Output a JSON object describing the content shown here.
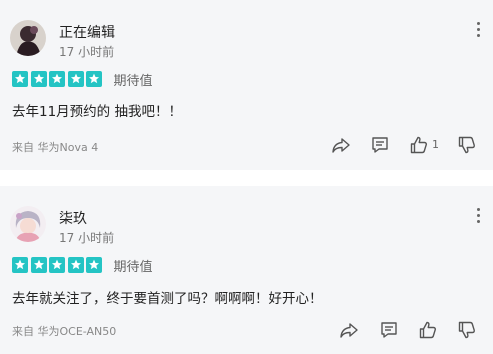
{
  "reviews": [
    {
      "username": "正在编辑",
      "time": "17 小时前",
      "rating_label": "期待值",
      "stars": 5,
      "content": "去年11月预约的 抽我吧！！",
      "device_prefix": "来自 ",
      "device": "华为Nova 4",
      "like_count": "1"
    },
    {
      "username": "柒玖",
      "time": "17 小时前",
      "rating_label": "期待值",
      "stars": 5,
      "content": "去年就关注了，终于要首测了吗？啊啊啊！好开心！",
      "device_prefix": "来自 ",
      "device": "华为OCE-AN50",
      "like_count": ""
    }
  ],
  "colors": {
    "star": "#24c4c4",
    "card_bg": "#f5f6f8",
    "icon": "#555555"
  },
  "icons": [
    "share-icon",
    "comment-icon",
    "thumbs-up-icon",
    "thumbs-down-icon",
    "more-vertical-icon"
  ]
}
